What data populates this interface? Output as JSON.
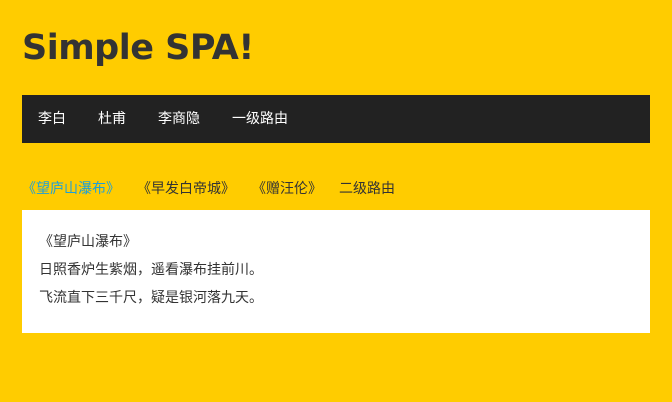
{
  "header": {
    "title": "Simple SPA!"
  },
  "top_nav": {
    "items": [
      {
        "label": "李白"
      },
      {
        "label": "杜甫"
      },
      {
        "label": "李商隐"
      },
      {
        "label": "一级路由"
      }
    ]
  },
  "sub_nav": {
    "items": [
      {
        "label": "《望庐山瀑布》",
        "active": true
      },
      {
        "label": "《早发白帝城》",
        "active": false
      },
      {
        "label": "《赠汪伦》",
        "active": false
      }
    ],
    "level_label": "二级路由"
  },
  "content": {
    "title": "《望庐山瀑布》",
    "line1": "日照香炉生紫烟，遥看瀑布挂前川。",
    "line2": "飞流直下三千尺，疑是银河落九天。"
  },
  "colors": {
    "background": "#FFCC00",
    "nav_background": "#222222",
    "active_link": "#1E9FD8",
    "panel_background": "#FFFFFF"
  }
}
